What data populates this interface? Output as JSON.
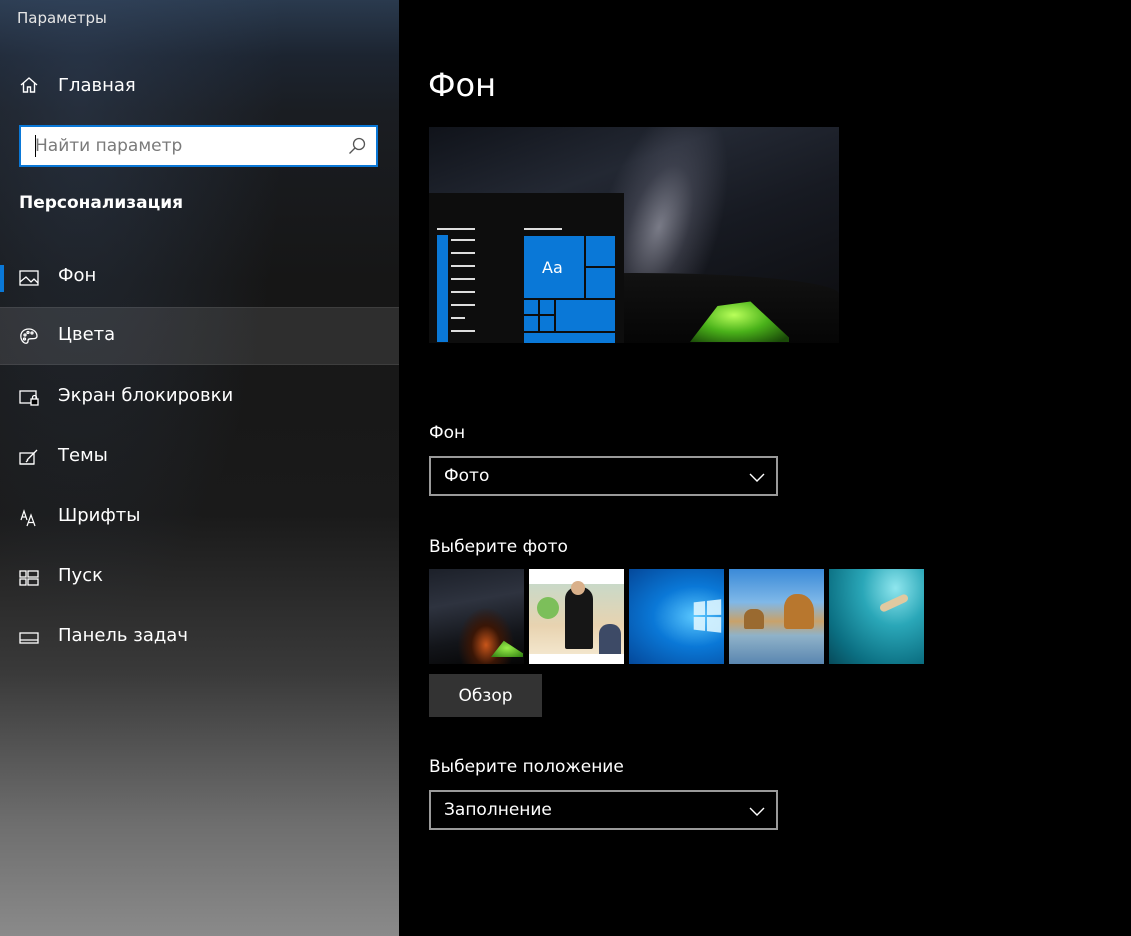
{
  "window": {
    "title": "Параметры"
  },
  "sidebar": {
    "home_label": "Главная",
    "search": {
      "placeholder": "Найти параметр"
    },
    "section_title": "Персонализация",
    "items": [
      {
        "label": "Фон",
        "icon": "picture-icon"
      },
      {
        "label": "Цвета",
        "icon": "palette-icon"
      },
      {
        "label": "Экран блокировки",
        "icon": "lock-screen-icon"
      },
      {
        "label": "Темы",
        "icon": "themes-icon"
      },
      {
        "label": "Шрифты",
        "icon": "fonts-icon"
      },
      {
        "label": "Пуск",
        "icon": "start-icon"
      },
      {
        "label": "Панель задач",
        "icon": "taskbar-icon"
      }
    ],
    "active_item": "Фон",
    "hovered_item": "Цвета"
  },
  "main": {
    "title": "Фон",
    "preview": {
      "tile_text": "Aa"
    },
    "background": {
      "label": "Фон",
      "value": "Фото"
    },
    "photos": {
      "label": "Выберите фото",
      "items": [
        "night-sky-tent-photo",
        "people-photo",
        "windows-logo-photo",
        "beach-rocks-photo",
        "underwater-swimmer-photo"
      ]
    },
    "browse_label": "Обзор",
    "fit": {
      "label": "Выберите положение",
      "value": "Заполнение"
    }
  },
  "colors": {
    "accent": "#0a78d7",
    "background": "#000000"
  }
}
